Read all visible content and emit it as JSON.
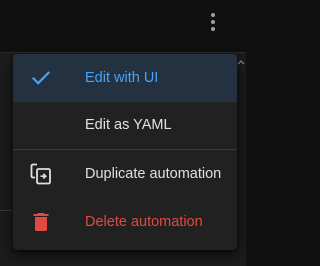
{
  "toolbar": {
    "overflow_icon": "more-vertical-icon"
  },
  "menu": {
    "items": [
      {
        "label": "Edit with UI",
        "icon": "check-icon",
        "selected": true
      },
      {
        "label": "Edit as YAML",
        "icon": ""
      },
      {
        "label": "Duplicate automation",
        "icon": "content-duplicate-icon"
      },
      {
        "label": "Delete automation",
        "icon": "delete-icon"
      }
    ]
  },
  "colors": {
    "accent": "#4aa3f0",
    "selected_bg": "#233140",
    "danger": "#e34a3f",
    "menu_bg": "#212121",
    "text": "#e1e1e1"
  }
}
